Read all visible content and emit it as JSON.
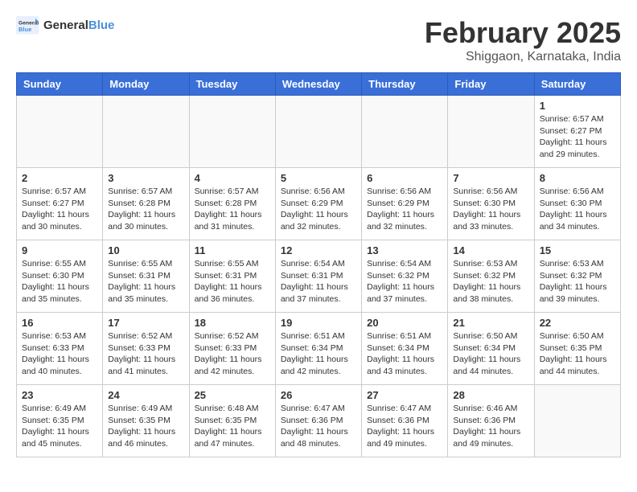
{
  "logo": {
    "text_general": "General",
    "text_blue": "Blue"
  },
  "header": {
    "month": "February 2025",
    "location": "Shiggaon, Karnataka, India"
  },
  "weekdays": [
    "Sunday",
    "Monday",
    "Tuesday",
    "Wednesday",
    "Thursday",
    "Friday",
    "Saturday"
  ],
  "weeks": [
    [
      {
        "day": "",
        "info": ""
      },
      {
        "day": "",
        "info": ""
      },
      {
        "day": "",
        "info": ""
      },
      {
        "day": "",
        "info": ""
      },
      {
        "day": "",
        "info": ""
      },
      {
        "day": "",
        "info": ""
      },
      {
        "day": "1",
        "info": "Sunrise: 6:57 AM\nSunset: 6:27 PM\nDaylight: 11 hours\nand 29 minutes."
      }
    ],
    [
      {
        "day": "2",
        "info": "Sunrise: 6:57 AM\nSunset: 6:27 PM\nDaylight: 11 hours\nand 30 minutes."
      },
      {
        "day": "3",
        "info": "Sunrise: 6:57 AM\nSunset: 6:28 PM\nDaylight: 11 hours\nand 30 minutes."
      },
      {
        "day": "4",
        "info": "Sunrise: 6:57 AM\nSunset: 6:28 PM\nDaylight: 11 hours\nand 31 minutes."
      },
      {
        "day": "5",
        "info": "Sunrise: 6:56 AM\nSunset: 6:29 PM\nDaylight: 11 hours\nand 32 minutes."
      },
      {
        "day": "6",
        "info": "Sunrise: 6:56 AM\nSunset: 6:29 PM\nDaylight: 11 hours\nand 32 minutes."
      },
      {
        "day": "7",
        "info": "Sunrise: 6:56 AM\nSunset: 6:30 PM\nDaylight: 11 hours\nand 33 minutes."
      },
      {
        "day": "8",
        "info": "Sunrise: 6:56 AM\nSunset: 6:30 PM\nDaylight: 11 hours\nand 34 minutes."
      }
    ],
    [
      {
        "day": "9",
        "info": "Sunrise: 6:55 AM\nSunset: 6:30 PM\nDaylight: 11 hours\nand 35 minutes."
      },
      {
        "day": "10",
        "info": "Sunrise: 6:55 AM\nSunset: 6:31 PM\nDaylight: 11 hours\nand 35 minutes."
      },
      {
        "day": "11",
        "info": "Sunrise: 6:55 AM\nSunset: 6:31 PM\nDaylight: 11 hours\nand 36 minutes."
      },
      {
        "day": "12",
        "info": "Sunrise: 6:54 AM\nSunset: 6:31 PM\nDaylight: 11 hours\nand 37 minutes."
      },
      {
        "day": "13",
        "info": "Sunrise: 6:54 AM\nSunset: 6:32 PM\nDaylight: 11 hours\nand 37 minutes."
      },
      {
        "day": "14",
        "info": "Sunrise: 6:53 AM\nSunset: 6:32 PM\nDaylight: 11 hours\nand 38 minutes."
      },
      {
        "day": "15",
        "info": "Sunrise: 6:53 AM\nSunset: 6:32 PM\nDaylight: 11 hours\nand 39 minutes."
      }
    ],
    [
      {
        "day": "16",
        "info": "Sunrise: 6:53 AM\nSunset: 6:33 PM\nDaylight: 11 hours\nand 40 minutes."
      },
      {
        "day": "17",
        "info": "Sunrise: 6:52 AM\nSunset: 6:33 PM\nDaylight: 11 hours\nand 41 minutes."
      },
      {
        "day": "18",
        "info": "Sunrise: 6:52 AM\nSunset: 6:33 PM\nDaylight: 11 hours\nand 42 minutes."
      },
      {
        "day": "19",
        "info": "Sunrise: 6:51 AM\nSunset: 6:34 PM\nDaylight: 11 hours\nand 42 minutes."
      },
      {
        "day": "20",
        "info": "Sunrise: 6:51 AM\nSunset: 6:34 PM\nDaylight: 11 hours\nand 43 minutes."
      },
      {
        "day": "21",
        "info": "Sunrise: 6:50 AM\nSunset: 6:34 PM\nDaylight: 11 hours\nand 44 minutes."
      },
      {
        "day": "22",
        "info": "Sunrise: 6:50 AM\nSunset: 6:35 PM\nDaylight: 11 hours\nand 44 minutes."
      }
    ],
    [
      {
        "day": "23",
        "info": "Sunrise: 6:49 AM\nSunset: 6:35 PM\nDaylight: 11 hours\nand 45 minutes."
      },
      {
        "day": "24",
        "info": "Sunrise: 6:49 AM\nSunset: 6:35 PM\nDaylight: 11 hours\nand 46 minutes."
      },
      {
        "day": "25",
        "info": "Sunrise: 6:48 AM\nSunset: 6:35 PM\nDaylight: 11 hours\nand 47 minutes."
      },
      {
        "day": "26",
        "info": "Sunrise: 6:47 AM\nSunset: 6:36 PM\nDaylight: 11 hours\nand 48 minutes."
      },
      {
        "day": "27",
        "info": "Sunrise: 6:47 AM\nSunset: 6:36 PM\nDaylight: 11 hours\nand 49 minutes."
      },
      {
        "day": "28",
        "info": "Sunrise: 6:46 AM\nSunset: 6:36 PM\nDaylight: 11 hours\nand 49 minutes."
      },
      {
        "day": "",
        "info": ""
      }
    ]
  ]
}
